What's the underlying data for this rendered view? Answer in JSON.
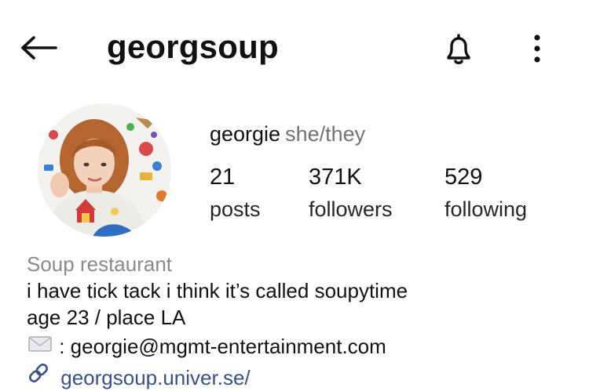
{
  "header": {
    "username": "georgsoup",
    "back_icon": "arrow-left-icon",
    "bell_icon": "bell-icon",
    "more_icon": "more-vertical-icon"
  },
  "profile": {
    "display_name": "georgie",
    "pronouns": "she/they",
    "avatar_icon": "profile-photo"
  },
  "stats": {
    "posts": {
      "value": "21",
      "label": "posts"
    },
    "followers": {
      "value": "371K",
      "label": "followers"
    },
    "following": {
      "value": "529",
      "label": "following"
    }
  },
  "bio": {
    "category": "Soup restaurant",
    "line1": "i have tick tack i think it’s called soupytime",
    "line2": "age 23 / place LA",
    "email_text": ": georgie@mgmt-entertainment.com",
    "email_icon": "envelope-icon",
    "link_text": "georgsoup.univer.se/",
    "link_icon": "link-icon"
  },
  "colors": {
    "text": "#111111",
    "muted": "#737373",
    "category": "#8a8a8a",
    "link": "#3b4f8a"
  }
}
